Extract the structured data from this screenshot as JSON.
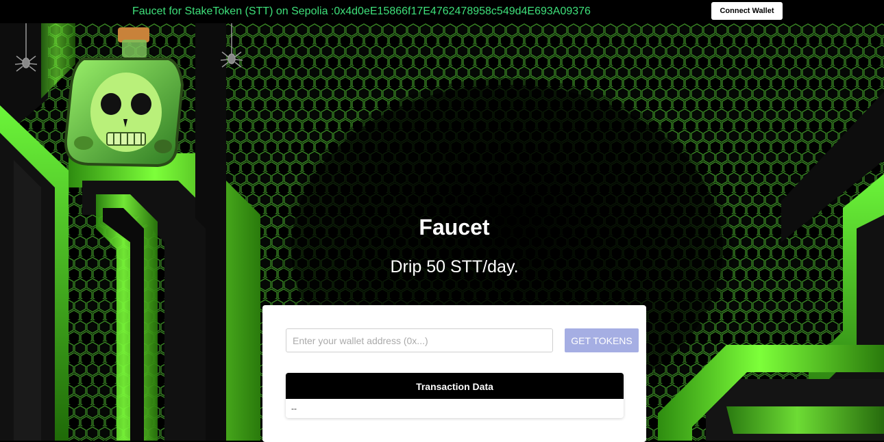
{
  "header": {
    "title": "Faucet for StakeToken (STT) on Sepolia :0x4d0eE15866f17E4762478958c549d4E693A09376",
    "connect_label": "Connect Wallet"
  },
  "hero": {
    "title": "Faucet",
    "subtitle": "Drip 50 STT/day."
  },
  "form": {
    "address_placeholder": "Enter your wallet address (0x...)",
    "address_value": "",
    "submit_label": "GET TOKENS"
  },
  "transactions": {
    "header": "Transaction Data",
    "rows": [
      "--"
    ]
  },
  "colors": {
    "accent_green": "#3ee07a",
    "neon_green": "#5ef52a",
    "button_disabled": "#a5aee3"
  }
}
